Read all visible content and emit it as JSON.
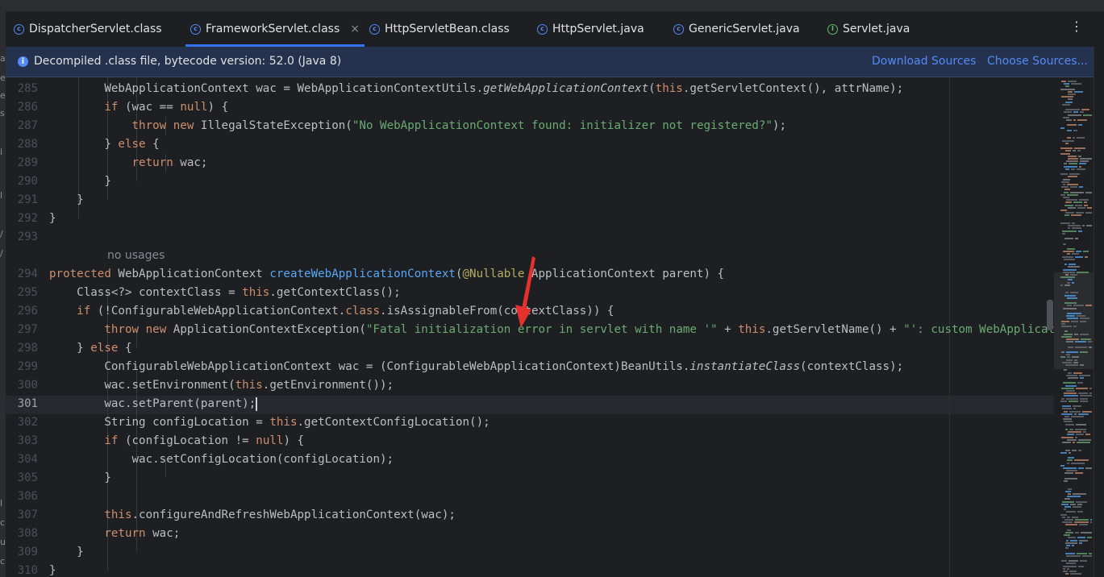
{
  "tabs": [
    {
      "label": "DispatcherServlet.class",
      "icon": "class-icon",
      "active": false
    },
    {
      "label": "FrameworkServlet.class",
      "icon": "class-icon",
      "active": true
    },
    {
      "label": "HttpServletBean.class",
      "icon": "class-icon",
      "active": false
    },
    {
      "label": "HttpServlet.java",
      "icon": "class-icon",
      "active": false
    },
    {
      "label": "GenericServlet.java",
      "icon": "class-icon",
      "active": false
    },
    {
      "label": "Servlet.java",
      "icon": "interface-icon",
      "active": false
    }
  ],
  "tab_close_glyph": "×",
  "more_glyph": "⋮",
  "banner": {
    "info_glyph": "i",
    "text": "Decompiled .class file, bytecode version: 52.0 (Java 8)",
    "download_link": "Download Sources",
    "choose_link": "Choose Sources..."
  },
  "editor": {
    "current_line": "301",
    "inlay_hint": "no usages",
    "lines": [
      {
        "n": "285",
        "t": "        WebApplicationContext wac = WebApplicationContextUtils.getWebApplicationContext(this.getServletContext(), attrName);"
      },
      {
        "n": "286",
        "t": "        if (wac == null) {"
      },
      {
        "n": "287",
        "t": "            throw new IllegalStateException(\"No WebApplicationContext found: initializer not registered?\");"
      },
      {
        "n": "288",
        "t": "        } else {"
      },
      {
        "n": "289",
        "t": "            return wac;"
      },
      {
        "n": "290",
        "t": "        }"
      },
      {
        "n": "291",
        "t": "    }"
      },
      {
        "n": "292",
        "t": "}"
      },
      {
        "n": "293",
        "t": ""
      },
      {
        "n": "",
        "t": ""
      },
      {
        "n": "294",
        "t": "protected WebApplicationContext createWebApplicationContext(@Nullable ApplicationContext parent) {"
      },
      {
        "n": "295",
        "t": "    Class<?> contextClass = this.getContextClass();"
      },
      {
        "n": "296",
        "t": "    if (!ConfigurableWebApplicationContext.class.isAssignableFrom(contextClass)) {"
      },
      {
        "n": "297",
        "t": "        throw new ApplicationContextException(\"Fatal initialization error in servlet with name '\" + this.getServletName() + \"': custom WebApplicationContext class [\" + contextClass.getName() + \"] is not of type ConfigurableWebApplicationContext\");"
      },
      {
        "n": "298",
        "t": "    } else {"
      },
      {
        "n": "299",
        "t": "        ConfigurableWebApplicationContext wac = (ConfigurableWebApplicationContext)BeanUtils.instantiateClass(contextClass);"
      },
      {
        "n": "300",
        "t": "        wac.setEnvironment(this.getEnvironment());"
      },
      {
        "n": "301",
        "t": "        wac.setParent(parent);"
      },
      {
        "n": "302",
        "t": "        String configLocation = this.getContextConfigLocation();"
      },
      {
        "n": "303",
        "t": "        if (configLocation != null) {"
      },
      {
        "n": "304",
        "t": "            wac.setConfigLocation(configLocation);"
      },
      {
        "n": "305",
        "t": "        }"
      },
      {
        "n": "306",
        "t": ""
      },
      {
        "n": "307",
        "t": "        this.configureAndRefreshWebApplicationContext(wac);"
      },
      {
        "n": "308",
        "t": "        return wac;"
      },
      {
        "n": "309",
        "t": "    }"
      },
      {
        "n": "310",
        "t": "}"
      }
    ]
  },
  "colors": {
    "keyword": "#cf8e6d",
    "string": "#6aab73",
    "method_declaration": "#56a8f5",
    "annotation": "#b3ae60",
    "accent": "#3574f0",
    "arrow": "#e5312b"
  }
}
